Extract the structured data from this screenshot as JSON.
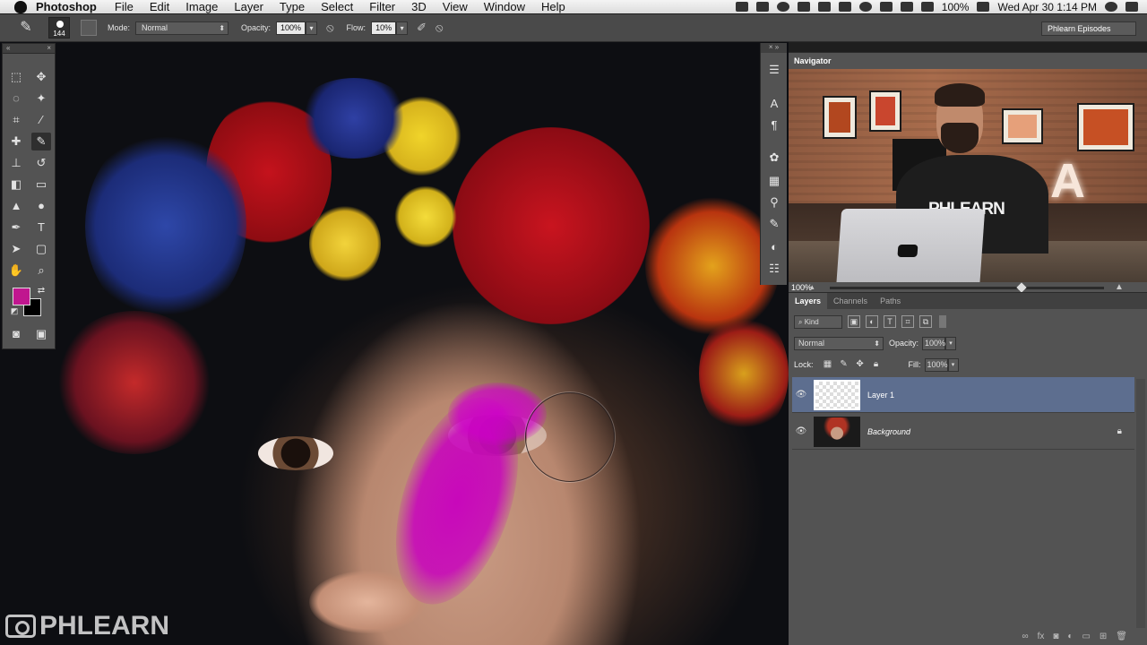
{
  "menubar": {
    "app_name": "Photoshop",
    "items": [
      "File",
      "Edit",
      "Image",
      "Layer",
      "Type",
      "Select",
      "Filter",
      "3D",
      "View",
      "Window",
      "Help"
    ],
    "battery": "100%",
    "datetime": "Wed Apr 30  1:14 PM"
  },
  "options": {
    "brush_size": "144",
    "mode_label": "Mode:",
    "mode_value": "Normal",
    "opacity_label": "Opacity:",
    "opacity_value": "100%",
    "flow_label": "Flow:",
    "flow_value": "10%",
    "workspace": "Phlearn Episodes"
  },
  "tools": {
    "foreground_color": "#c0168f",
    "background_color": "#000000"
  },
  "navigator": {
    "tab": "Navigator",
    "zoom": "100%",
    "video_shirt_text": "PHLEARN",
    "video_sign_letter": "A"
  },
  "layers_panel": {
    "tabs": [
      "Layers",
      "Channels",
      "Paths"
    ],
    "kind_filter": "Kind",
    "blend_mode": "Normal",
    "opacity_label": "Opacity:",
    "opacity_value": "100%",
    "lock_label": "Lock:",
    "fill_label": "Fill:",
    "fill_value": "100%",
    "layers": [
      {
        "name": "Layer 1",
        "selected": true,
        "locked": false
      },
      {
        "name": "Background",
        "selected": false,
        "locked": true
      }
    ]
  },
  "canvas": {
    "paint_color": "#c800be",
    "watermark": "PHLEARN"
  }
}
